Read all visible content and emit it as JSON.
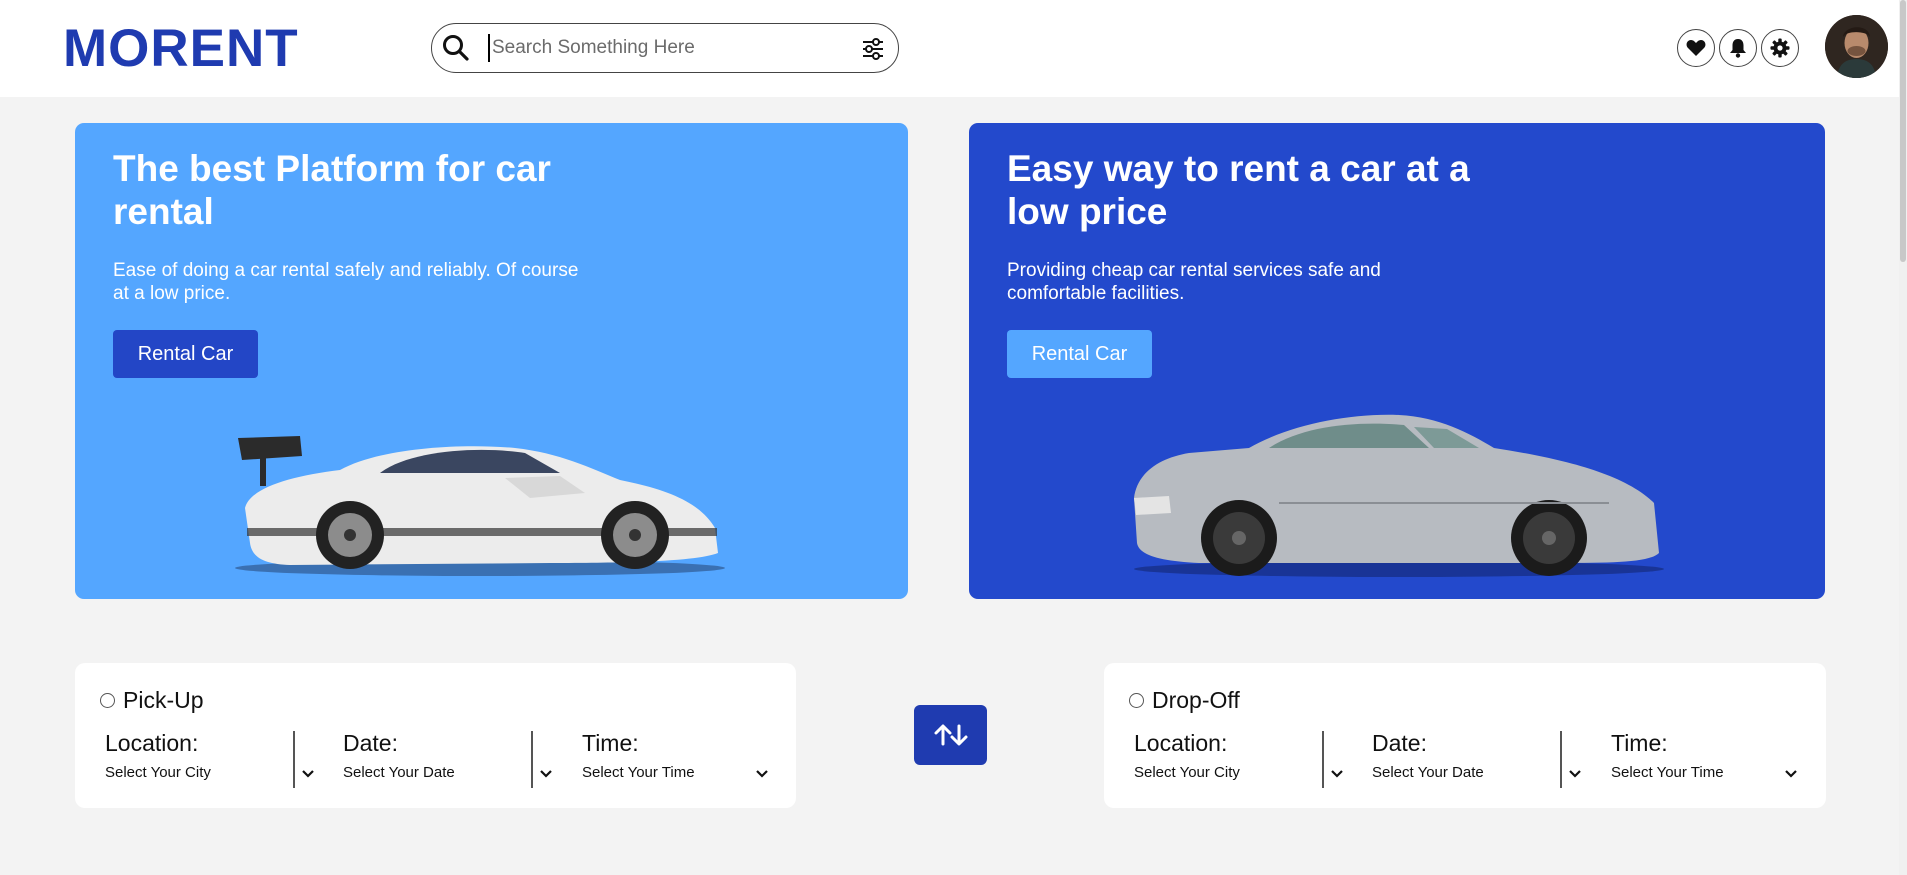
{
  "header": {
    "logo": "MORENT",
    "search_placeholder": "Search Something Here"
  },
  "hero": [
    {
      "title": "The best Platform for car rental",
      "description": "Ease of doing a car rental safely and reliably. Of course at a low price.",
      "button_label": "Rental Car"
    },
    {
      "title": "Easy way to rent a car at a low price",
      "description": "Providing cheap car rental services safe and comfortable facilities.",
      "button_label": "Rental Car"
    }
  ],
  "pickup": {
    "title": "Pick-Up",
    "location_label": "Location:",
    "location_value": "Select Your City",
    "date_label": "Date:",
    "date_value": "Select Your Date",
    "time_label": "Time:",
    "time_value": "Select Your Time"
  },
  "dropoff": {
    "title": "Drop-Off",
    "location_label": "Location:",
    "location_value": "Select Your City",
    "date_label": "Date:",
    "date_value": "Select Your Date",
    "time_label": "Time:",
    "time_value": "Select Your Time"
  },
  "colors": {
    "brand": "#1f3bb0",
    "hero_left": "#54a6ff",
    "hero_right": "#2349cc",
    "background": "#f3f3f3"
  },
  "icons": [
    "search-icon",
    "filter-icon",
    "heart-icon",
    "bell-icon",
    "gear-icon",
    "swap-icon",
    "chevron-down-icon"
  ]
}
